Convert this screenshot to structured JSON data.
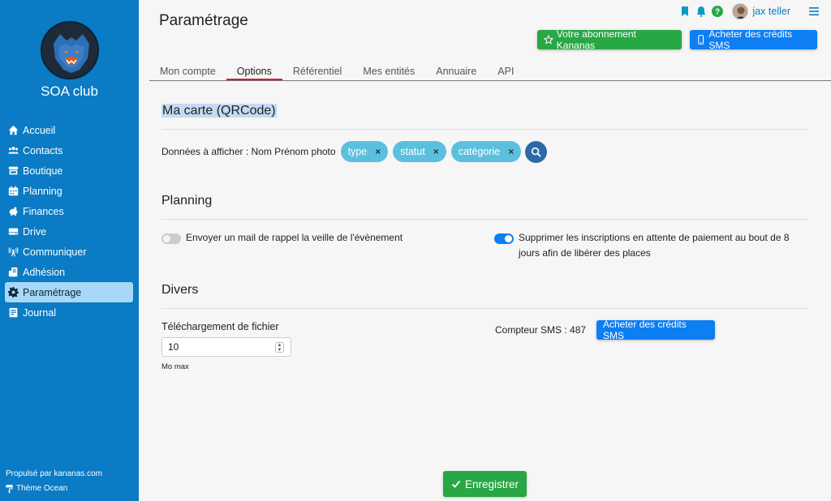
{
  "app": {
    "club_name": "SOA club",
    "footer_powered": "Propulsé par kananas.com",
    "footer_theme": "Thème Ocean"
  },
  "colors": {
    "sidebar": "#0a7bc4",
    "active_item": "#a8d8f8",
    "accent_blue": "#0d7ff2",
    "green": "#28a745",
    "chip": "#5bc0de",
    "tab_underline": "#d81e2b"
  },
  "sidebar": {
    "items": [
      {
        "label": "Accueil",
        "icon": "home-icon"
      },
      {
        "label": "Contacts",
        "icon": "users-icon"
      },
      {
        "label": "Boutique",
        "icon": "store-icon"
      },
      {
        "label": "Planning",
        "icon": "calendar-icon"
      },
      {
        "label": "Finances",
        "icon": "piggy-bank-icon"
      },
      {
        "label": "Drive",
        "icon": "drive-icon"
      },
      {
        "label": "Communiquer",
        "icon": "broadcast-icon"
      },
      {
        "label": "Adhésion",
        "icon": "id-card-icon"
      },
      {
        "label": "Paramétrage",
        "icon": "gear-icon",
        "active": true
      },
      {
        "label": "Journal",
        "icon": "journal-icon"
      }
    ]
  },
  "header": {
    "title": "Paramétrage",
    "user_name": "jax teller",
    "subscription_button": "Votre abonnement Kananas",
    "buy_sms_button": "Acheter des crédits SMS"
  },
  "tabs": [
    {
      "label": "Mon compte"
    },
    {
      "label": "Options",
      "active": true
    },
    {
      "label": "Référentiel"
    },
    {
      "label": "Mes entités"
    },
    {
      "label": "Annuaire"
    },
    {
      "label": "API"
    }
  ],
  "card_section": {
    "title": "Ma carte (QRCode)",
    "display_label": "Données à afficher : Nom Prénom photo",
    "chips": [
      "type",
      "statut",
      "catégorie"
    ],
    "chip_remove": "×"
  },
  "planning_section": {
    "title": "Planning",
    "option1": {
      "label": "Envoyer un mail de rappel la veille de l'évènement",
      "enabled": false
    },
    "option2": {
      "label_line1": "Supprimer les inscriptions en attente de paiement au bout de 8",
      "label_line2": "jours afin de libérer des places",
      "enabled": true
    }
  },
  "divers_section": {
    "title": "Divers",
    "file_label": "Téléchargement de fichier",
    "file_value": "10",
    "file_unit": "Mo max",
    "sms_counter": "Compteur SMS : 487",
    "buy_sms_button": "Acheter des crédits SMS"
  },
  "save_button": "Enregistrer"
}
